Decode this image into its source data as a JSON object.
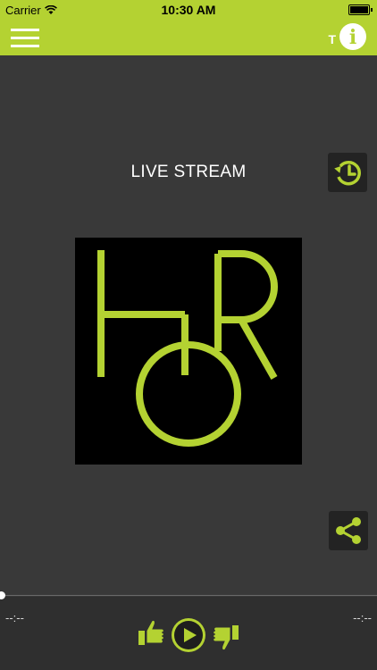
{
  "status_bar": {
    "carrier": "Carrier",
    "time": "10:30 AM"
  },
  "nav": {
    "t_label": "T",
    "info_label": "i"
  },
  "player": {
    "title": "LIVE STREAM",
    "elapsed": "--:--",
    "remaining": "--:--",
    "progress": 0
  },
  "colors": {
    "accent": "#b4d232",
    "background": "#393939",
    "bottom_bar": "#2f2f2f",
    "button_bg": "#232323"
  },
  "icons": [
    "wifi-icon",
    "battery-icon",
    "menu-icon",
    "info-icon",
    "history-icon",
    "share-icon",
    "thumbs-up-icon",
    "play-icon",
    "thumbs-down-icon"
  ]
}
